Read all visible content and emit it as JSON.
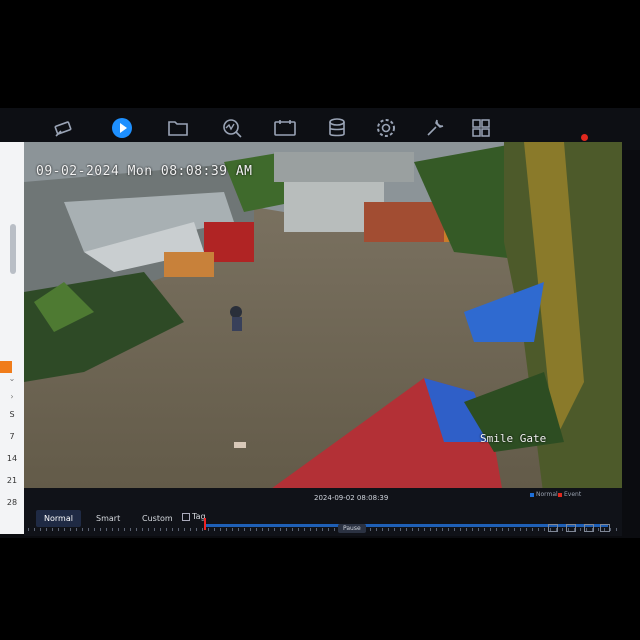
{
  "toolbar": {
    "icons": [
      "camera-icon",
      "play-icon",
      "folder-icon",
      "analytics-icon",
      "video-tag-icon",
      "storage-icon",
      "gear-icon",
      "wrench-icon",
      "grid-icon"
    ],
    "active_color": "#1e90ff",
    "icon_color": "#9aa4b6"
  },
  "sidebar": {
    "calendar_days": [
      "S",
      "7",
      "14",
      "21",
      "28"
    ]
  },
  "video": {
    "osd_datetime": "09-02-2024 Mon 08:08:39 AM",
    "osd_camera_name": "Smile Gate"
  },
  "playback": {
    "tabs": [
      "Normal",
      "Smart",
      "Custom"
    ],
    "tag_label": "Tag",
    "timeline_datetime": "2024-09-02 08:08:39",
    "pause_label": "Pause",
    "legend_normal": "Normal",
    "legend_event": "Event",
    "legend_normal_color": "#1e6fd9",
    "legend_event_color": "#e0281e"
  }
}
